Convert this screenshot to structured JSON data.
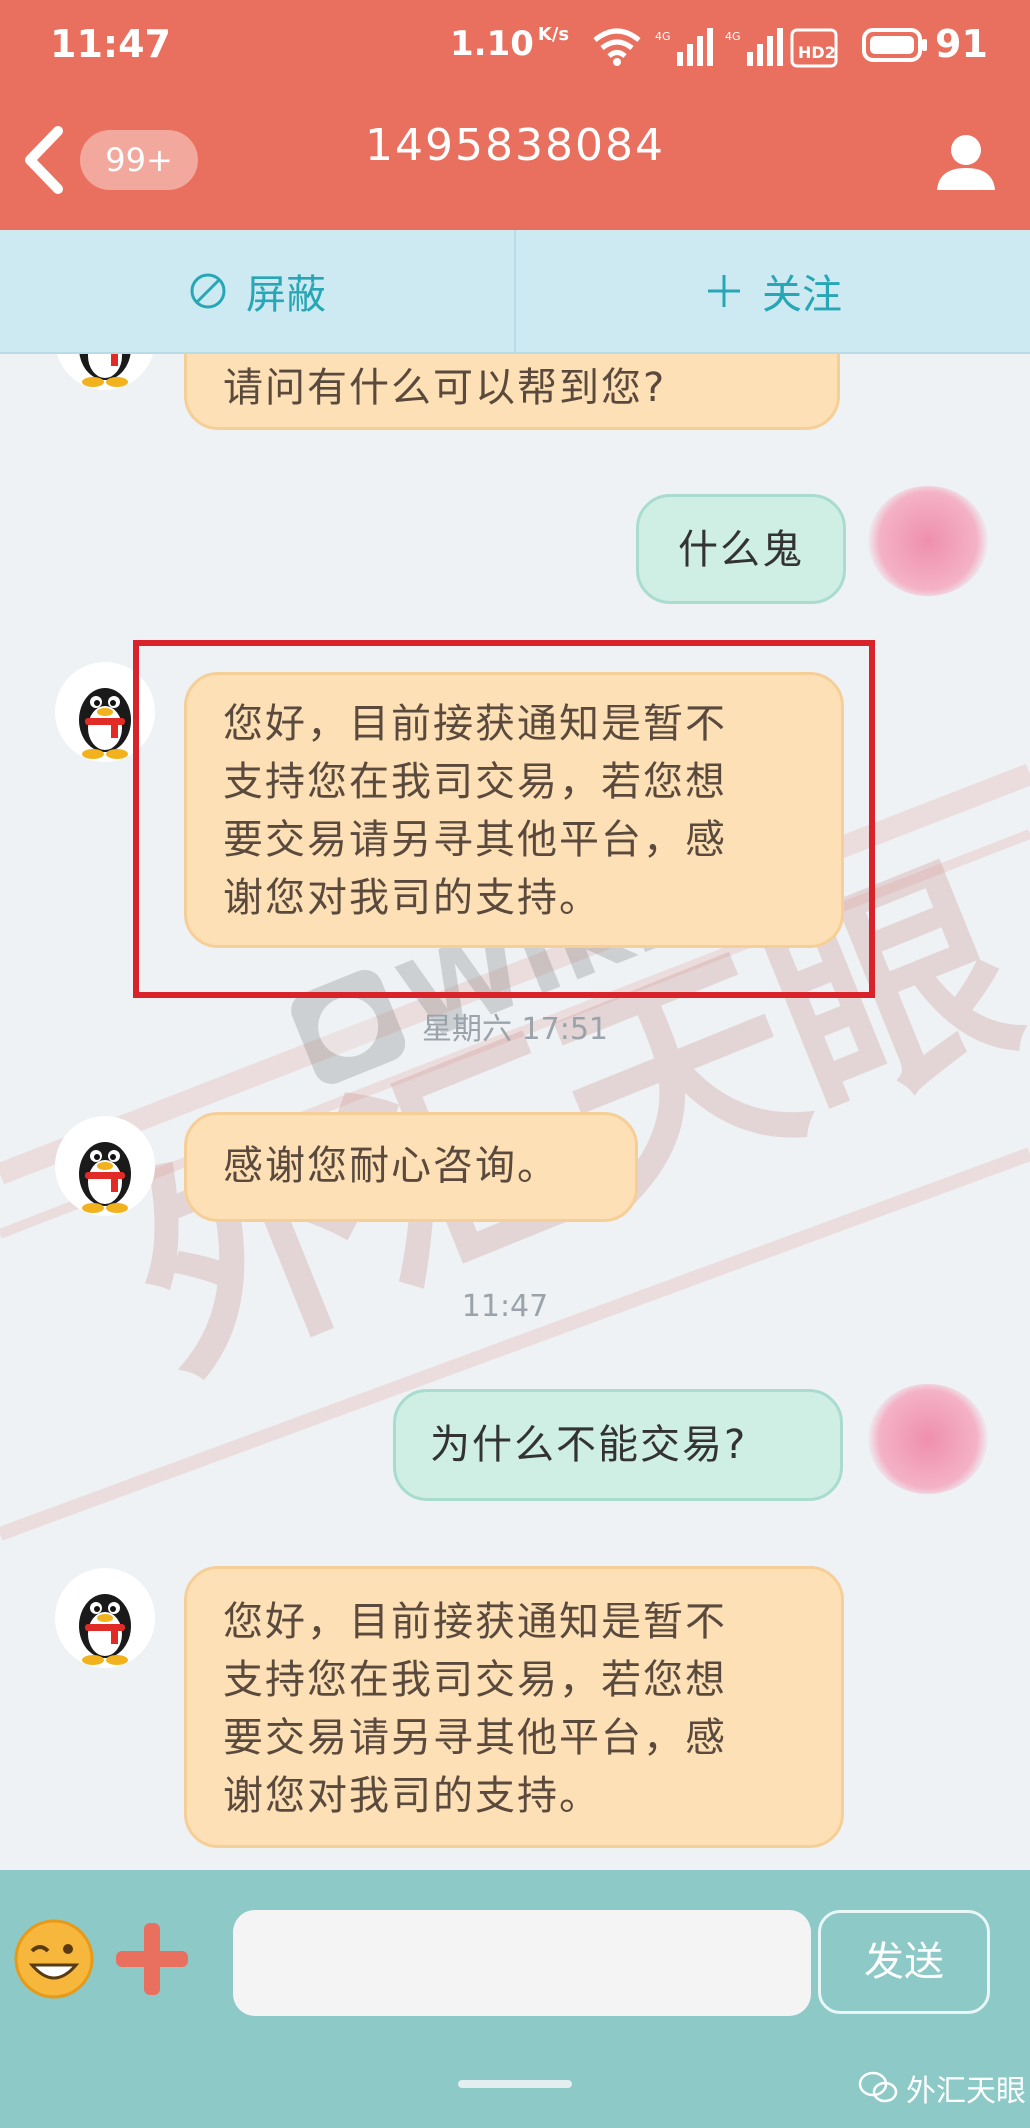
{
  "status_bar": {
    "time": "11:47",
    "network_speed": "1.10",
    "network_speed_unit": "K/s",
    "signal_1_label": "4G",
    "signal_2_label": "4G",
    "hd_label": "HD2",
    "battery": "91"
  },
  "header": {
    "unread_badge": "99+",
    "title": "1495838084"
  },
  "actions": {
    "block_label": "屏蔽",
    "follow_label": "关注"
  },
  "messages": [
    {
      "side": "in",
      "text": "请问有什么可以帮到您?"
    },
    {
      "side": "out",
      "text": "什么鬼"
    },
    {
      "side": "in",
      "text": "您好，目前接获通知是暂不支持您在我司交易，若您想要交易请另寻其他平台，感谢您对我司的支持。",
      "lines": [
        "您好，目前接获通知是暂不",
        "支持您在我司交易，若您想",
        "要交易请另寻其他平台，感",
        "谢您对我司的支持。"
      ]
    },
    {
      "side": "in",
      "text": "感谢您耐心咨询。"
    },
    {
      "side": "out",
      "text": "为什么不能交易?"
    },
    {
      "side": "in",
      "text": "您好，目前接获通知是暂不支持您在我司交易，若您想要交易请另寻其他平台，感谢您对我司的支持。",
      "lines": [
        "您好，目前接获通知是暂不",
        "支持您在我司交易，若您想",
        "要交易请另寻其他平台，感",
        "谢您对我司的支持。"
      ]
    }
  ],
  "timestamps": [
    "星期六 17:51",
    "11:47"
  ],
  "watermark": {
    "brand": "WikiFX",
    "chinese": "外汇天眼"
  },
  "input_bar": {
    "send_label": "发送",
    "brand_label": "外汇天眼"
  },
  "colors": {
    "header": "#e9705f",
    "action_bar": "#cdeaf3",
    "incoming_bubble": "#fde0b5",
    "outgoing_bubble": "#cfeee4",
    "input_bar": "#8cc9c7",
    "highlight_box": "#d9232a"
  },
  "icons": [
    "back-chevron-icon",
    "profile-icon",
    "block-icon",
    "plus-icon",
    "penguin-avatar-icon",
    "emoji-icon",
    "add-icon",
    "wechat-icon"
  ]
}
